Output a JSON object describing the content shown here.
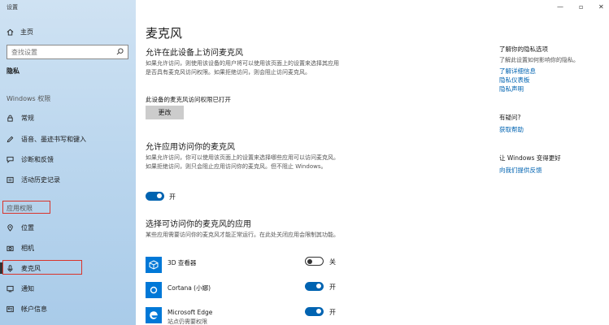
{
  "window": {
    "title": "设置",
    "minimize": "—",
    "restore": "▫",
    "close": "✕"
  },
  "sidebar": {
    "home_label": "主页",
    "search_placeholder": "查找设置",
    "section_title": "隐私",
    "windows_group": "Windows 权限",
    "windows_items": [
      {
        "label": "常规",
        "icon": "lock-icon"
      },
      {
        "label": "语音、墨迹书写和键入",
        "icon": "pen-icon"
      },
      {
        "label": "诊断和反馈",
        "icon": "feedback-icon"
      },
      {
        "label": "活动历史记录",
        "icon": "history-icon"
      }
    ],
    "app_group": "应用权限",
    "app_items": [
      {
        "label": "位置",
        "icon": "location-icon"
      },
      {
        "label": "相机",
        "icon": "camera-icon"
      },
      {
        "label": "麦克风",
        "icon": "microphone-icon"
      },
      {
        "label": "通知",
        "icon": "notification-icon"
      },
      {
        "label": "帐户信息",
        "icon": "account-icon"
      }
    ]
  },
  "main": {
    "title": "麦克风",
    "section1": {
      "heading": "允许在此设备上访问麦克风",
      "desc": "如果允许访问，则使用该设备的用户将可以使用该页面上的设置来选择其应用是否具有麦克风访问权限。如果拒绝访问，则会阻止访问麦克风。",
      "status": "此设备的麦克风访问权限已打开",
      "button": "更改"
    },
    "section2": {
      "heading": "允许应用访问你的麦克风",
      "desc": "如果允许访问，你可以使用该页面上的设置来选择哪些应用可以访问麦克风。如果拒绝访问，则只会阻止应用访问你的麦克风。但不阻止 Windows。",
      "toggle_state": "开"
    },
    "section3": {
      "heading": "选择可访问你的麦克风的应用",
      "desc": "某些应用需要访问你的麦克风才能正常运行。在此处关闭应用会限制其功能。",
      "apps": [
        {
          "name": "3D 查看器",
          "sub": "",
          "state": "关",
          "on": false,
          "icon": "cube-icon"
        },
        {
          "name": "Cortana (小娜)",
          "sub": "",
          "state": "开",
          "on": true,
          "icon": "cortana-icon"
        },
        {
          "name": "Microsoft Edge",
          "sub": "站点仍需要权限",
          "state": "开",
          "on": true,
          "icon": "edge-icon"
        }
      ]
    }
  },
  "right": {
    "privacy_head": "了解你的隐私选项",
    "privacy_text": "了解此设置如何影响你的隐私。",
    "links1": [
      "了解详细信息",
      "隐私仪表板",
      "隐私声明"
    ],
    "question_head": "有疑问?",
    "help_link": "获取帮助",
    "better_head": "让 Windows 变得更好",
    "feedback_link": "向我们提供反馈"
  },
  "colors": {
    "accent": "#0063b1",
    "highlight_box": "#d9342b"
  }
}
